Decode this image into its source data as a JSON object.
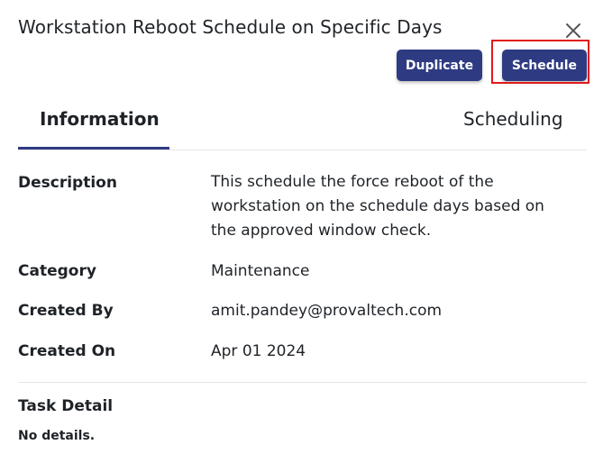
{
  "dialog": {
    "title": "Workstation Reboot Schedule on Specific Days"
  },
  "actions": {
    "duplicate_label": "Duplicate",
    "schedule_label": "Schedule"
  },
  "tabs": [
    {
      "label": "Information",
      "active": true
    },
    {
      "label": "Scheduling",
      "active": false
    }
  ],
  "info": {
    "description_label": "Description",
    "description_value": "This schedule the force reboot of the workstation on the schedule days based on the approved window check.",
    "category_label": "Category",
    "category_value": "Maintenance",
    "created_by_label": "Created By",
    "created_by_value": "amit.pandey@provaltech.com",
    "created_on_label": "Created On",
    "created_on_value": "Apr 01 2024"
  },
  "task_detail": {
    "title": "Task Detail",
    "body": "No details."
  },
  "colors": {
    "primary_button": "#2e3b82",
    "highlight_border": "#e01b1b",
    "tab_underline": "#2e3b82"
  },
  "icons": {
    "close": "close-icon"
  }
}
